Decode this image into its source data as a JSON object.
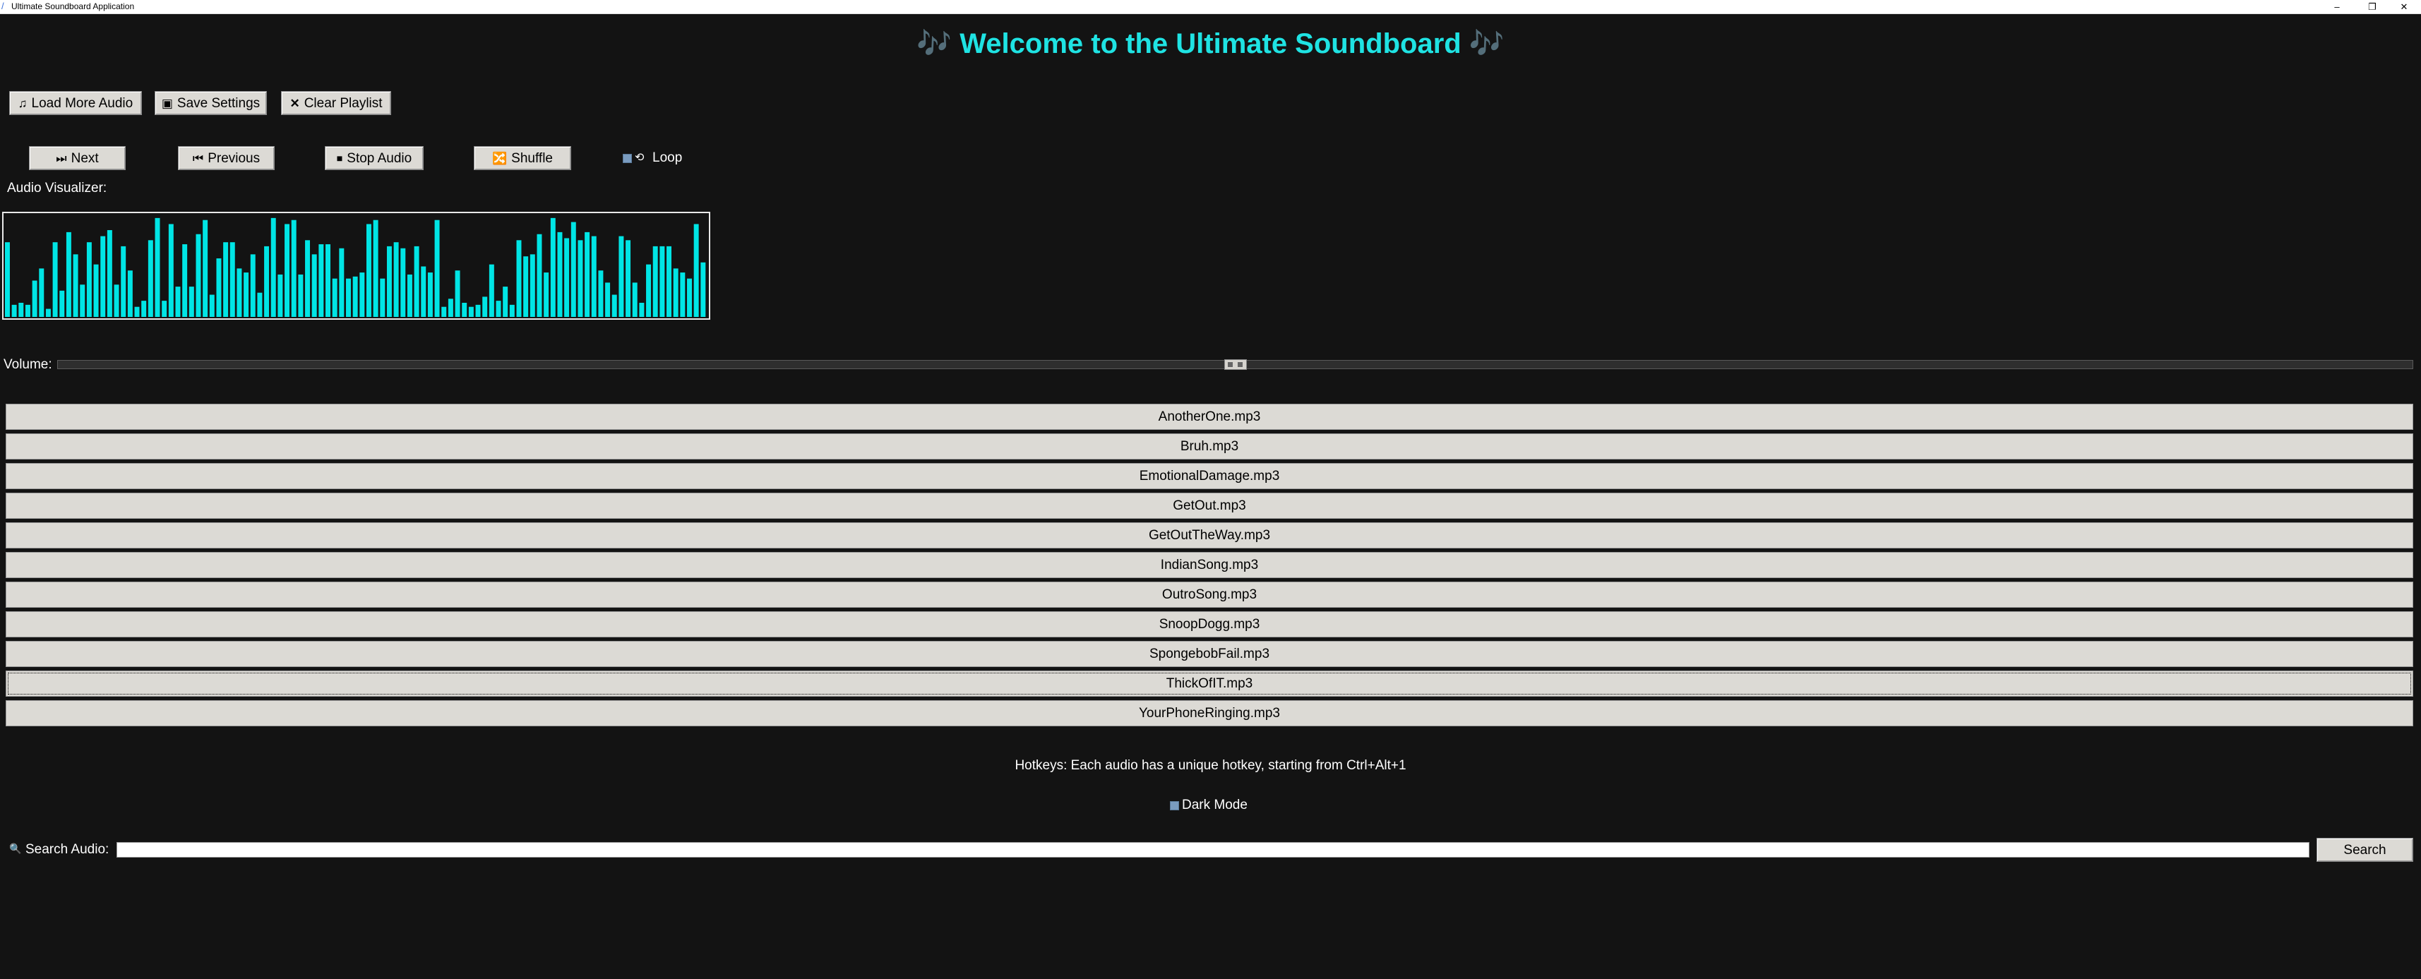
{
  "window": {
    "title": "Ultimate Soundboard Application",
    "controls": [
      "–",
      "❐",
      "✕"
    ]
  },
  "heading": "🎶 Welcome to the Ultimate Soundboard 🎶",
  "toolbar": {
    "load_label": "Load More Audio",
    "save_label": "Save Settings",
    "clear_label": "Clear Playlist",
    "load_icon": "music-note-icon",
    "save_icon": "floppy-disk-icon",
    "clear_icon": "close-icon"
  },
  "controls": {
    "next_label": "Next",
    "previous_label": "Previous",
    "stop_label": "Stop Audio",
    "shuffle_label": "Shuffle",
    "loop_label": "Loop",
    "loop_checked": true
  },
  "visualizer": {
    "label": "Audio Visualizer:",
    "bar_color": "#00e5e5",
    "levels": [
      0.74,
      0.12,
      0.14,
      0.12,
      0.36,
      0.48,
      0.08,
      0.74,
      0.26,
      0.84,
      0.62,
      0.32,
      0.74,
      0.52,
      0.8,
      0.86,
      0.32,
      0.7,
      0.46,
      0.1,
      0.16,
      0.76,
      0.98,
      0.16,
      0.92,
      0.3,
      0.72,
      0.3,
      0.82,
      0.96,
      0.22,
      0.58,
      0.74,
      0.74,
      0.48,
      0.44,
      0.62,
      0.24,
      0.7,
      0.98,
      0.42,
      0.92,
      0.96,
      0.42,
      0.76,
      0.62,
      0.72,
      0.72,
      0.38,
      0.68,
      0.38,
      0.4,
      0.44,
      0.92,
      0.96,
      0.38,
      0.7,
      0.74,
      0.68,
      0.42,
      0.7,
      0.5,
      0.44,
      0.96,
      0.1,
      0.18,
      0.46,
      0.14,
      0.1,
      0.12,
      0.2,
      0.52,
      0.16,
      0.3,
      0.12,
      0.76,
      0.6,
      0.62,
      0.82,
      0.44,
      0.98,
      0.84,
      0.78,
      0.94,
      0.76,
      0.84,
      0.8,
      0.46,
      0.34,
      0.22,
      0.8,
      0.76,
      0.34,
      0.14,
      0.52,
      0.7,
      0.7,
      0.7,
      0.48,
      0.44,
      0.38,
      0.92,
      0.54
    ]
  },
  "volume": {
    "label": "Volume:",
    "level": 0.5
  },
  "playlist": [
    "AnotherOne.mp3",
    "Bruh.mp3",
    "EmotionalDamage.mp3",
    "GetOut.mp3",
    "GetOutTheWay.mp3",
    "IndianSong.mp3",
    "OutroSong.mp3",
    "SnoopDogg.mp3",
    "SpongebobFail.mp3",
    "ThickOfIT.mp3",
    "YourPhoneRinging.mp3"
  ],
  "selected_index": 9,
  "hotkeys_text": "Hotkeys: Each audio has a unique hotkey, starting from Ctrl+Alt+1",
  "dark_mode": {
    "label": "Dark Mode",
    "checked": true
  },
  "search": {
    "label": "Search Audio:",
    "value": "",
    "button_label": "Search",
    "icon": "magnifier-icon"
  },
  "colors": {
    "background": "#131313",
    "accent": "#1fe3e3",
    "button_face": "#dcdad5"
  }
}
